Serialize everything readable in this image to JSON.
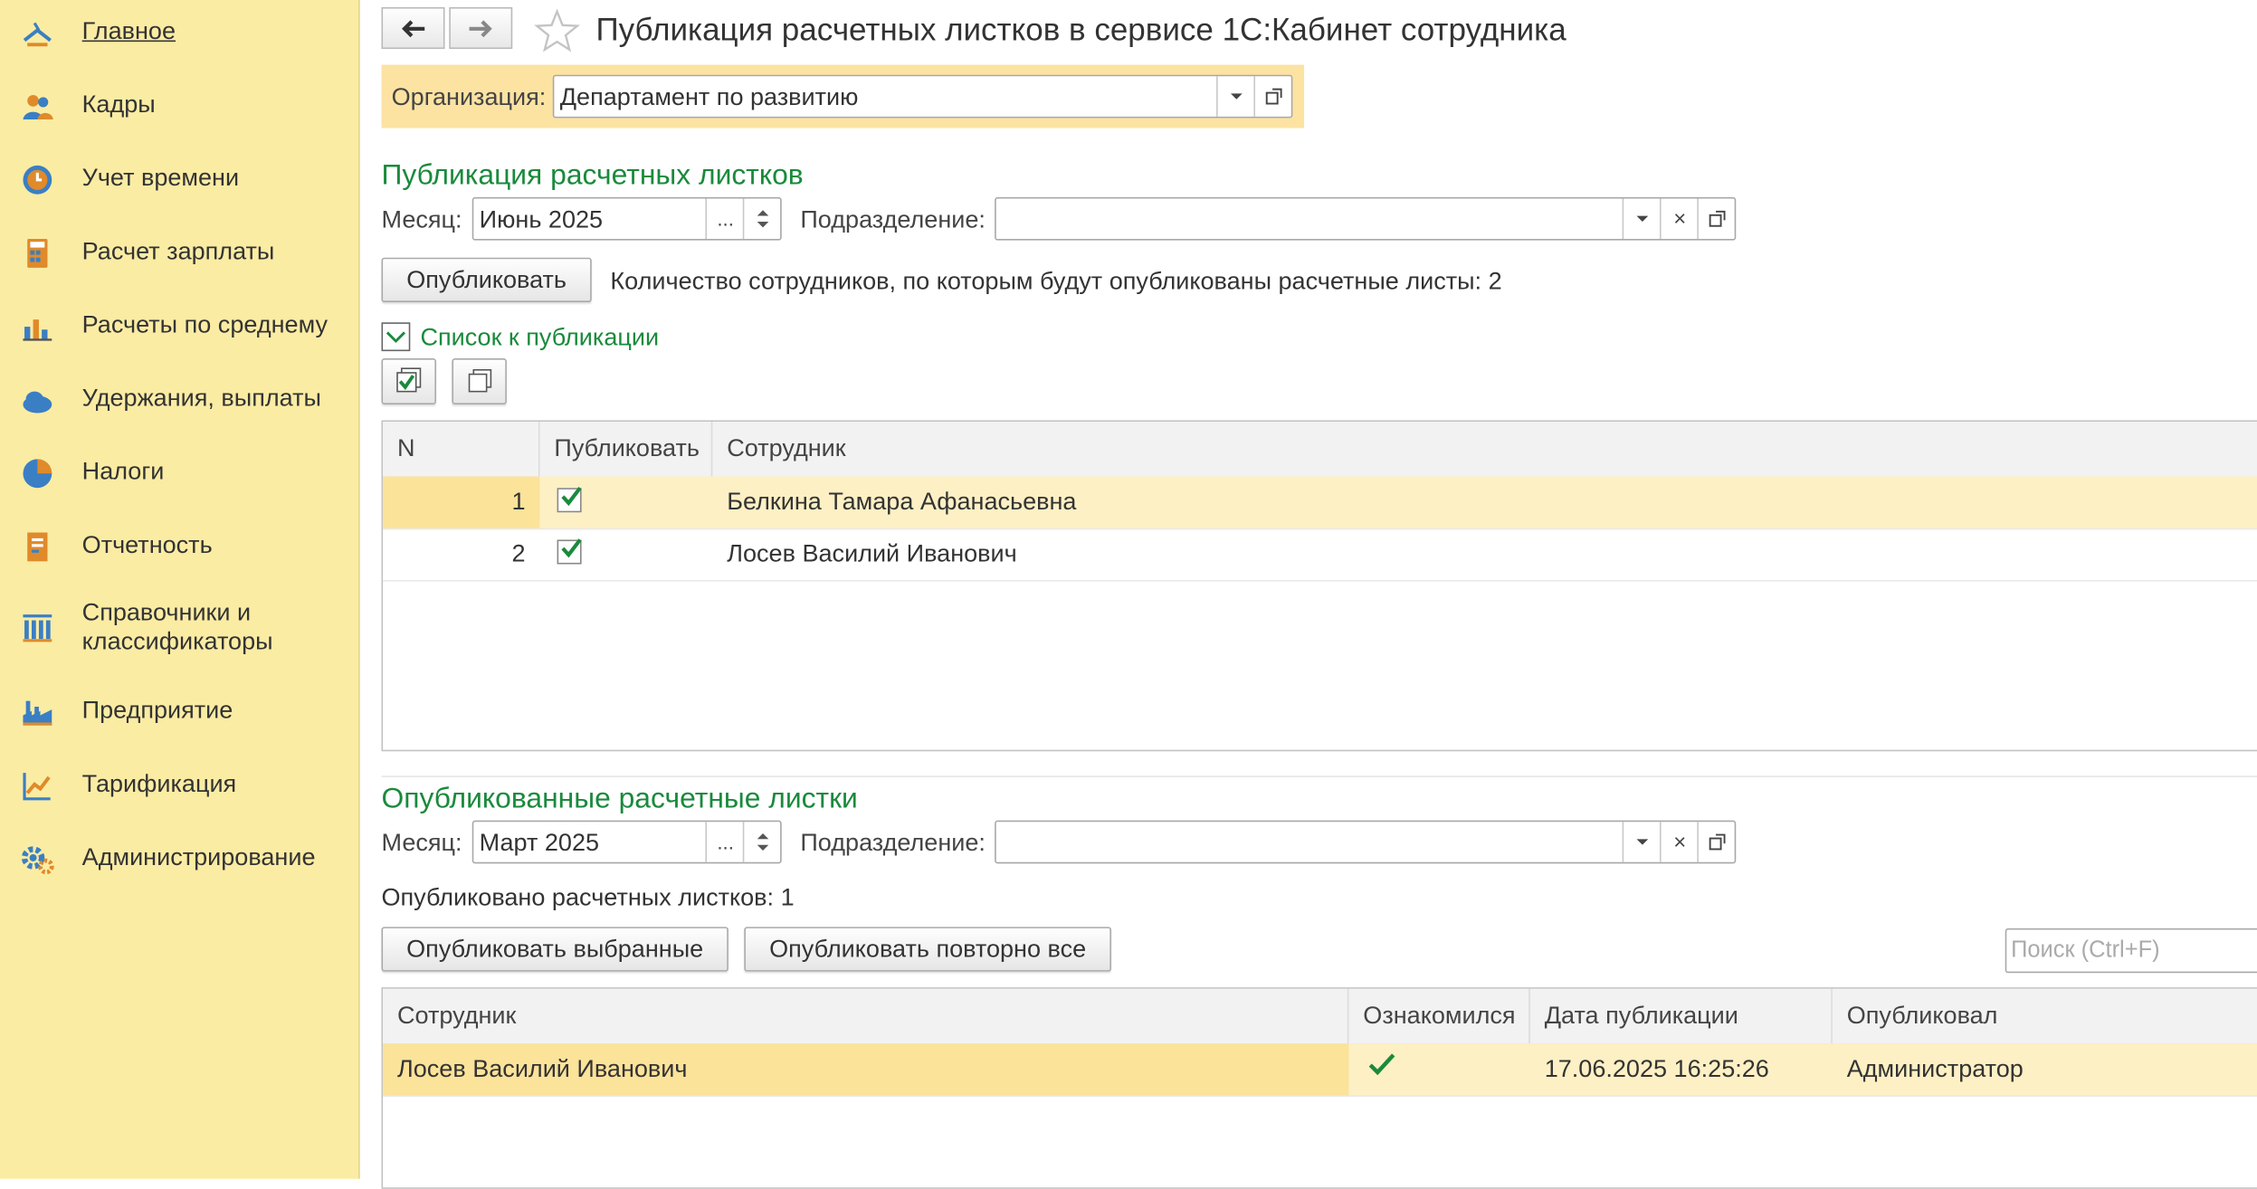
{
  "sidebar": {
    "items": [
      {
        "label": "Главное",
        "icon": "home-icon",
        "active": true
      },
      {
        "label": "Кадры",
        "icon": "people-icon"
      },
      {
        "label": "Учет времени",
        "icon": "clock-icon"
      },
      {
        "label": "Расчет зарплаты",
        "icon": "calculator-icon"
      },
      {
        "label": "Расчеты по среднему",
        "icon": "bar-chart-icon"
      },
      {
        "label": "Удержания, выплаты",
        "icon": "cloud-icon"
      },
      {
        "label": "Налоги",
        "icon": "pie-chart-icon"
      },
      {
        "label": "Отчетность",
        "icon": "report-icon"
      },
      {
        "label": "Справочники и",
        "label2": "классификаторы",
        "icon": "catalog-icon"
      },
      {
        "label": "Предприятие",
        "icon": "factory-icon"
      },
      {
        "label": "Тарификация",
        "icon": "tariff-icon"
      },
      {
        "label": "Администрирование",
        "icon": "gear-icon"
      }
    ]
  },
  "header": {
    "title": "Публикация расчетных листков в сервисе 1С:Кабинет сотрудника",
    "back_icon": "arrow-left-icon",
    "forward_icon": "arrow-right-icon",
    "favorite_icon": "star-icon"
  },
  "organization": {
    "label": "Организация:",
    "value": "Департамент по развитию"
  },
  "publication": {
    "title": "Публикация расчетных листков",
    "month_label": "Месяц:",
    "month_value": "Июнь 2025",
    "dept_label": "Подразделение:",
    "dept_value": "",
    "publish_button": "Опубликовать",
    "count_text": "Количество сотрудников, по которым будут опубликованы расчетные листы: 2",
    "list_toggle_label": "Список к публикации",
    "table": {
      "columns": [
        "N",
        "Публиковать",
        "Сотрудник"
      ],
      "rows": [
        {
          "n": "1",
          "publish": true,
          "employee": "Белкина Тамара Афанасьевна"
        },
        {
          "n": "2",
          "publish": true,
          "employee": "Лосев Василий Иванович"
        }
      ]
    }
  },
  "published": {
    "title": "Опубликованные расчетные листки",
    "month_label": "Месяц:",
    "month_value": "Март 2025",
    "dept_label": "Подразделение:",
    "dept_value": "",
    "count_text": "Опубликовано расчетных листков: 1",
    "publish_selected_button": "Опубликовать выбранные",
    "republish_all_button": "Опубликовать повторно все",
    "search_placeholder": "Поиск (Ctrl+F)",
    "table": {
      "columns": [
        "Сотрудник",
        "Ознакомился",
        "Дата публикации",
        "Опубликовал"
      ],
      "rows": [
        {
          "employee": "Лосев Василий Иванович",
          "acknowledged": true,
          "date": "17.06.2025 16:25:26",
          "publisher": "Администратор"
        }
      ]
    }
  },
  "colors": {
    "sidebar_bg": "#fbeca4",
    "accent_green": "#1a8a3c",
    "selected_row": "#fdf0c4",
    "selected_cell": "#fbe39a"
  }
}
